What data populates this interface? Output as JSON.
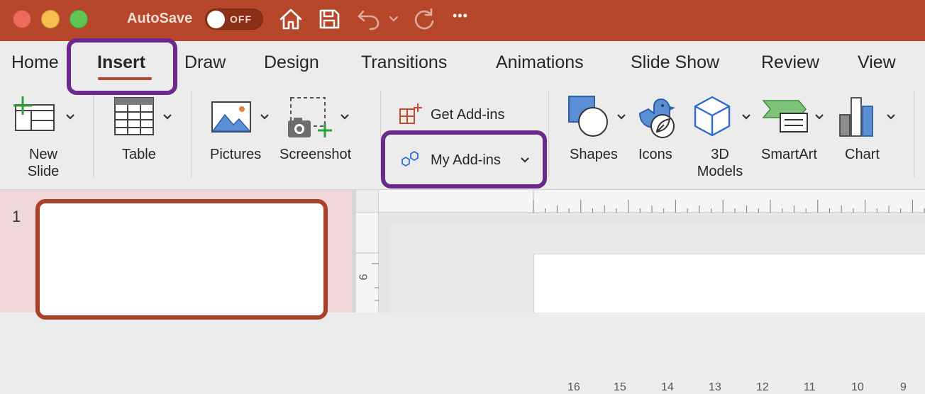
{
  "titlebar": {
    "autosave_label": "AutoSave",
    "autosave_state": "OFF",
    "more_label": "•••",
    "accent_color": "#b7472a"
  },
  "tabs": [
    {
      "label": "Home"
    },
    {
      "label": "Insert",
      "active": true
    },
    {
      "label": "Draw"
    },
    {
      "label": "Design"
    },
    {
      "label": "Transitions"
    },
    {
      "label": "Animations"
    },
    {
      "label": "Slide Show"
    },
    {
      "label": "Review"
    },
    {
      "label": "View"
    }
  ],
  "ribbon": {
    "new_slide": {
      "line1": "New",
      "line2": "Slide"
    },
    "table": "Table",
    "pictures": "Pictures",
    "screenshot": "Screenshot",
    "get_addins": "Get Add-ins",
    "my_addins": "My Add-ins",
    "shapes": "Shapes",
    "icons": "Icons",
    "models_3d": {
      "line1": "3D",
      "line2": "Models"
    },
    "smartart": "SmartArt",
    "chart": "Chart"
  },
  "slides": {
    "number": "1"
  },
  "ruler": {
    "top_numbers": [
      "16",
      "15",
      "14",
      "13",
      "12",
      "11",
      "10",
      "9"
    ],
    "left_number": "9"
  },
  "highlight_color": "#6b2a8a"
}
